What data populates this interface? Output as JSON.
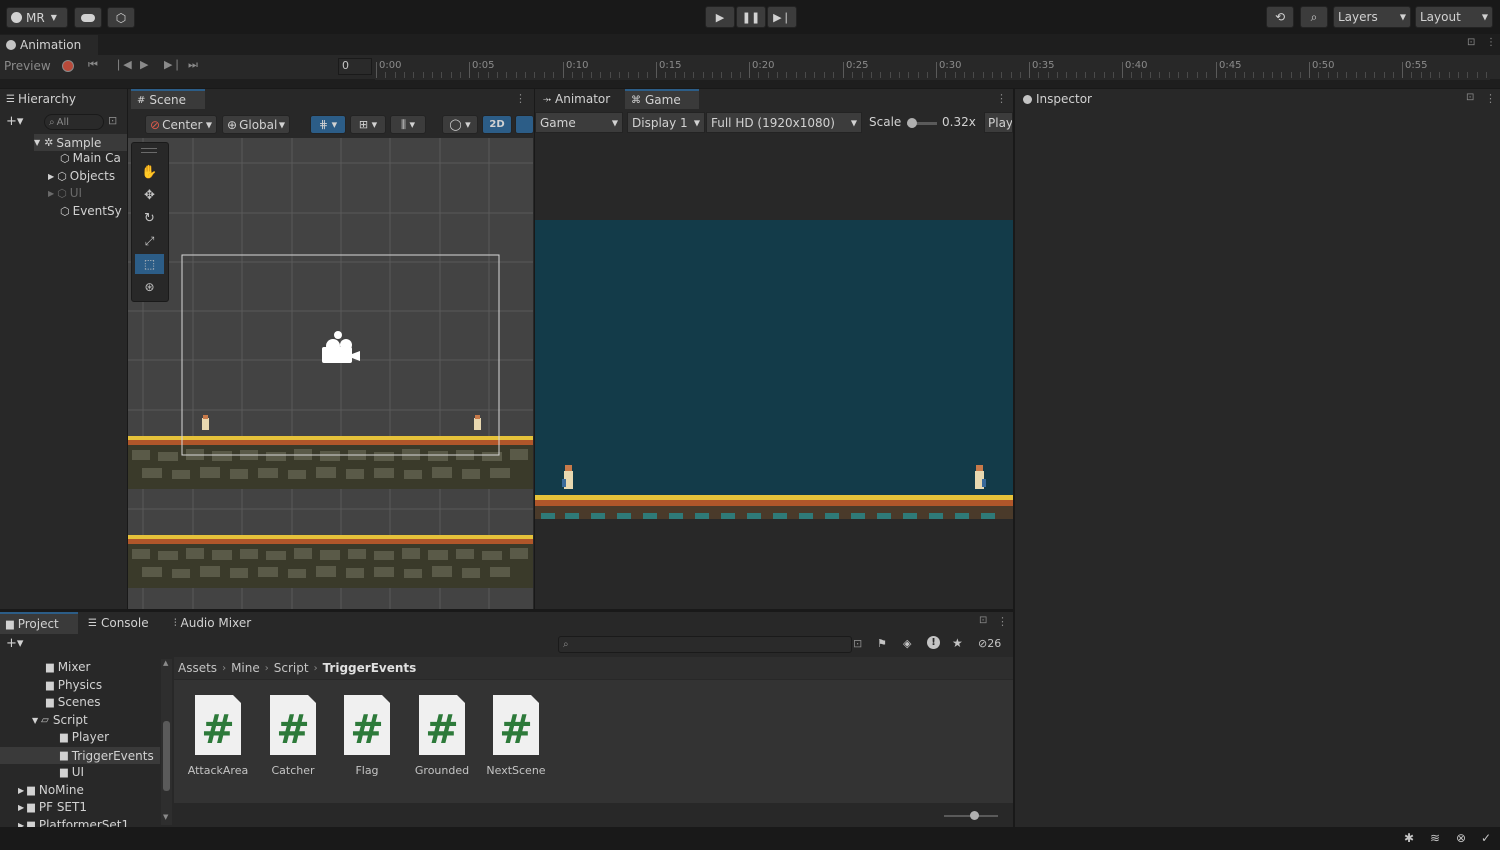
{
  "toolbar": {
    "account_label": "MR",
    "layers_label": "Layers",
    "layout_label": "Layout"
  },
  "animation": {
    "tab_label": "Animation",
    "preview_label": "Preview",
    "frame_value": "0",
    "ruler_labels": [
      "0:00",
      "0:05",
      "0:10",
      "0:15",
      "0:20",
      "0:25",
      "0:30",
      "0:35",
      "0:40",
      "0:45",
      "0:50",
      "0:55"
    ]
  },
  "hierarchy": {
    "tab_label": "Hierarchy",
    "search_placeholder": "All",
    "items": [
      {
        "label": "Sample"
      },
      {
        "label": "Main Ca"
      },
      {
        "label": "Objects"
      },
      {
        "label": "UI"
      },
      {
        "label": "EventSy"
      }
    ]
  },
  "scene": {
    "tab_label": "Scene",
    "pivot_label": "Center",
    "space_label": "Global",
    "mode_2d_label": "2D"
  },
  "game": {
    "animator_tab_label": "Animator",
    "tab_label": "Game",
    "view_label": "Game",
    "display_label": "Display 1",
    "resolution_label": "Full HD (1920x1080)",
    "scale_label": "Scale",
    "scale_value": "0.32x",
    "play_label": "Play"
  },
  "inspector": {
    "tab_label": "Inspector"
  },
  "project": {
    "tabs": [
      {
        "label": "Project"
      },
      {
        "label": "Console"
      },
      {
        "label": "Audio Mixer"
      }
    ],
    "hidden_count": "26",
    "breadcrumb": [
      {
        "label": "Assets"
      },
      {
        "label": "Mine"
      },
      {
        "label": "Script"
      },
      {
        "label": "TriggerEvents"
      }
    ],
    "folders": [
      {
        "label": "Mixer"
      },
      {
        "label": "Physics"
      },
      {
        "label": "Scenes"
      },
      {
        "label": "Script"
      },
      {
        "label": "Player"
      },
      {
        "label": "TriggerEvents"
      },
      {
        "label": "UI"
      },
      {
        "label": "NoMine"
      },
      {
        "label": "PF SET1"
      },
      {
        "label": "PlatformerSet1"
      }
    ],
    "files": [
      {
        "label": "AttackArea"
      },
      {
        "label": "Catcher"
      },
      {
        "label": "Flag"
      },
      {
        "label": "Grounded"
      },
      {
        "label": "NextScene"
      }
    ]
  },
  "colors": {
    "accent": "#2c5d87",
    "game_sky": "#133b49",
    "scene_bg": "#434343",
    "file_hash": "#2d7a3a"
  }
}
